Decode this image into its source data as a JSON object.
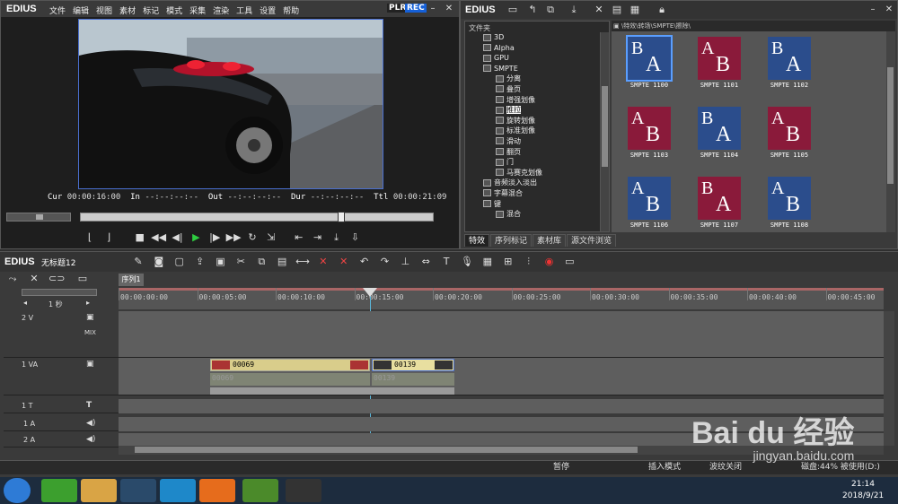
{
  "player": {
    "brand": "EDIUS",
    "menu": [
      "文件",
      "编辑",
      "视图",
      "素材",
      "标记",
      "模式",
      "采集",
      "渲染",
      "工具",
      "设置",
      "帮助"
    ],
    "plr": "PLR",
    "rec": "REC",
    "timecodes": {
      "cur_label": "Cur",
      "cur": "00:00:16:00",
      "in_label": "In",
      "in": "--:--:--:--",
      "out_label": "Out",
      "out": "--:--:--:--",
      "dur_label": "Dur",
      "dur": "--:--:--:--",
      "ttl_label": "Ttl",
      "ttl": "00:00:21:09"
    }
  },
  "effects": {
    "brand": "EDIUS",
    "folder_header": "文件夹",
    "path": "\\特效\\转场\\SMPTE\\擦除\\",
    "tree": [
      {
        "label": "3D",
        "indent": 1
      },
      {
        "label": "Alpha",
        "indent": 1
      },
      {
        "label": "GPU",
        "indent": 1
      },
      {
        "label": "SMPTE",
        "indent": 1
      },
      {
        "label": "分离",
        "indent": 2
      },
      {
        "label": "叠页",
        "indent": 2
      },
      {
        "label": "增强划像",
        "indent": 2
      },
      {
        "label": "推拉",
        "indent": 2,
        "selected": true
      },
      {
        "label": "旋转划像",
        "indent": 2
      },
      {
        "label": "标准划像",
        "indent": 2
      },
      {
        "label": "滑动",
        "indent": 2
      },
      {
        "label": "翻页",
        "indent": 2
      },
      {
        "label": "门",
        "indent": 2
      },
      {
        "label": "马赛克划像",
        "indent": 2
      },
      {
        "label": "音频淡入淡出",
        "indent": 1
      },
      {
        "label": "字幕混合",
        "indent": 1
      },
      {
        "label": "键",
        "indent": 1
      },
      {
        "label": "混合",
        "indent": 2
      }
    ],
    "thumbnails": [
      {
        "label": "SMPTE 1100",
        "l1": "B",
        "l2": "A"
      },
      {
        "label": "SMPTE 1101",
        "l1": "A",
        "l2": "B"
      },
      {
        "label": "SMPTE 1102",
        "l1": "B",
        "l2": "A"
      },
      {
        "label": "SMPTE 1103",
        "l1": "A",
        "l2": "B"
      },
      {
        "label": "SMPTE 1104",
        "l1": "B",
        "l2": "A"
      },
      {
        "label": "SMPTE 1105",
        "l1": "A",
        "l2": "B"
      },
      {
        "label": "SMPTE 1106",
        "l1": "A",
        "l2": "B"
      },
      {
        "label": "SMPTE 1107",
        "l1": "B",
        "l2": "A"
      },
      {
        "label": "SMPTE 1108",
        "l1": "A",
        "l2": "B"
      }
    ],
    "tabs": [
      "特效",
      "序列标记",
      "素材库",
      "源文件浏览"
    ]
  },
  "timeline": {
    "brand": "EDIUS",
    "project": "无标题12",
    "sequence_tab": "序列1",
    "zoom": "1 秒",
    "ruler": [
      "00:00:00:00",
      "00:00:05:00",
      "00:00:10:00",
      "00:00:15:00",
      "00:00:20:00",
      "00:00:25:00",
      "00:00:30:00",
      "00:00:35:00",
      "00:00:40:00",
      "00:00:45:00"
    ],
    "tracks": {
      "v2": "2 V",
      "mix": "MIX",
      "va1": "1 VA",
      "t1": "1 T",
      "a1": "1 A",
      "a2": "2 A"
    },
    "clips": [
      {
        "name": "00069",
        "ghost": "00069"
      },
      {
        "name": "00139",
        "ghost": "00139"
      }
    ]
  },
  "status": {
    "state": "暂停",
    "mode": "插入模式",
    "ripple": "波纹关闭",
    "disk": "磁盘:44% 被使用(D:)"
  },
  "taskbar": {
    "time": "21:14",
    "date": "2018/9/21"
  },
  "watermark": {
    "brand": "Bai du 经验",
    "url": "jingyan.baidu.com"
  }
}
